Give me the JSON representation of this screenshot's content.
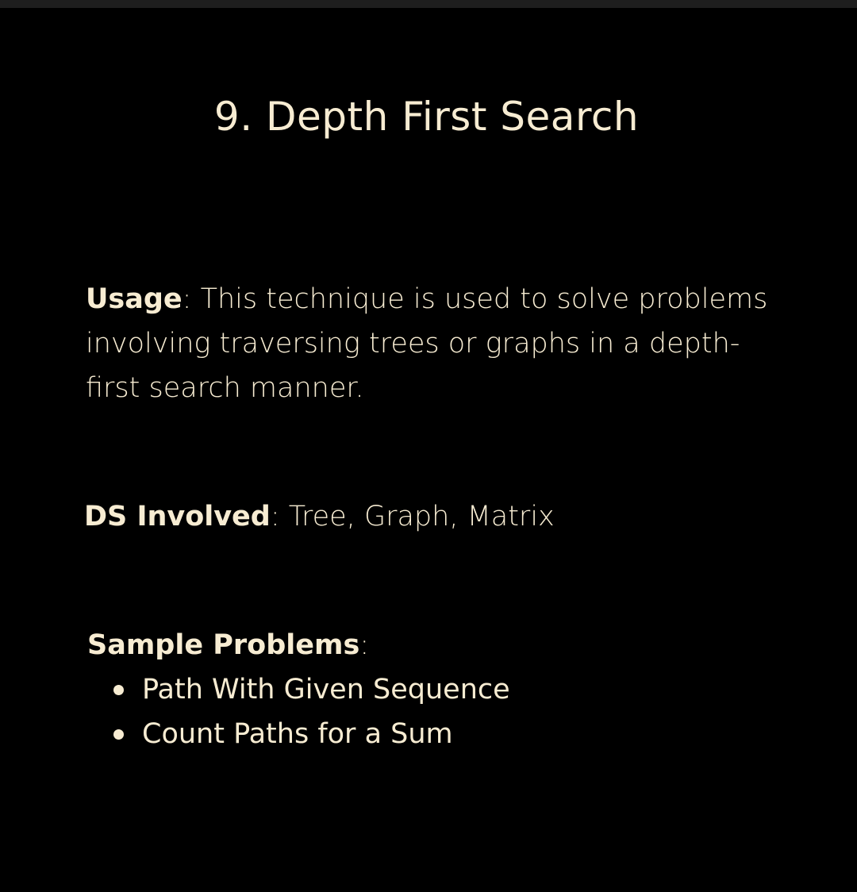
{
  "title": "9. Depth First Search",
  "usage": {
    "label": "Usage",
    "separator": ":",
    "text": " This technique is used to solve problems involving traversing trees or graphs in a depth-first search manner."
  },
  "ds_involved": {
    "label": "DS Involved",
    "separator": ":",
    "text": " Tree, Graph, Matrix"
  },
  "sample_problems": {
    "label": "Sample Problems",
    "separator": ":",
    "items": [
      "Path With Given Sequence",
      "Count Paths for a Sum"
    ]
  },
  "colors": {
    "background": "#000000",
    "text": "#f7ecd2"
  }
}
